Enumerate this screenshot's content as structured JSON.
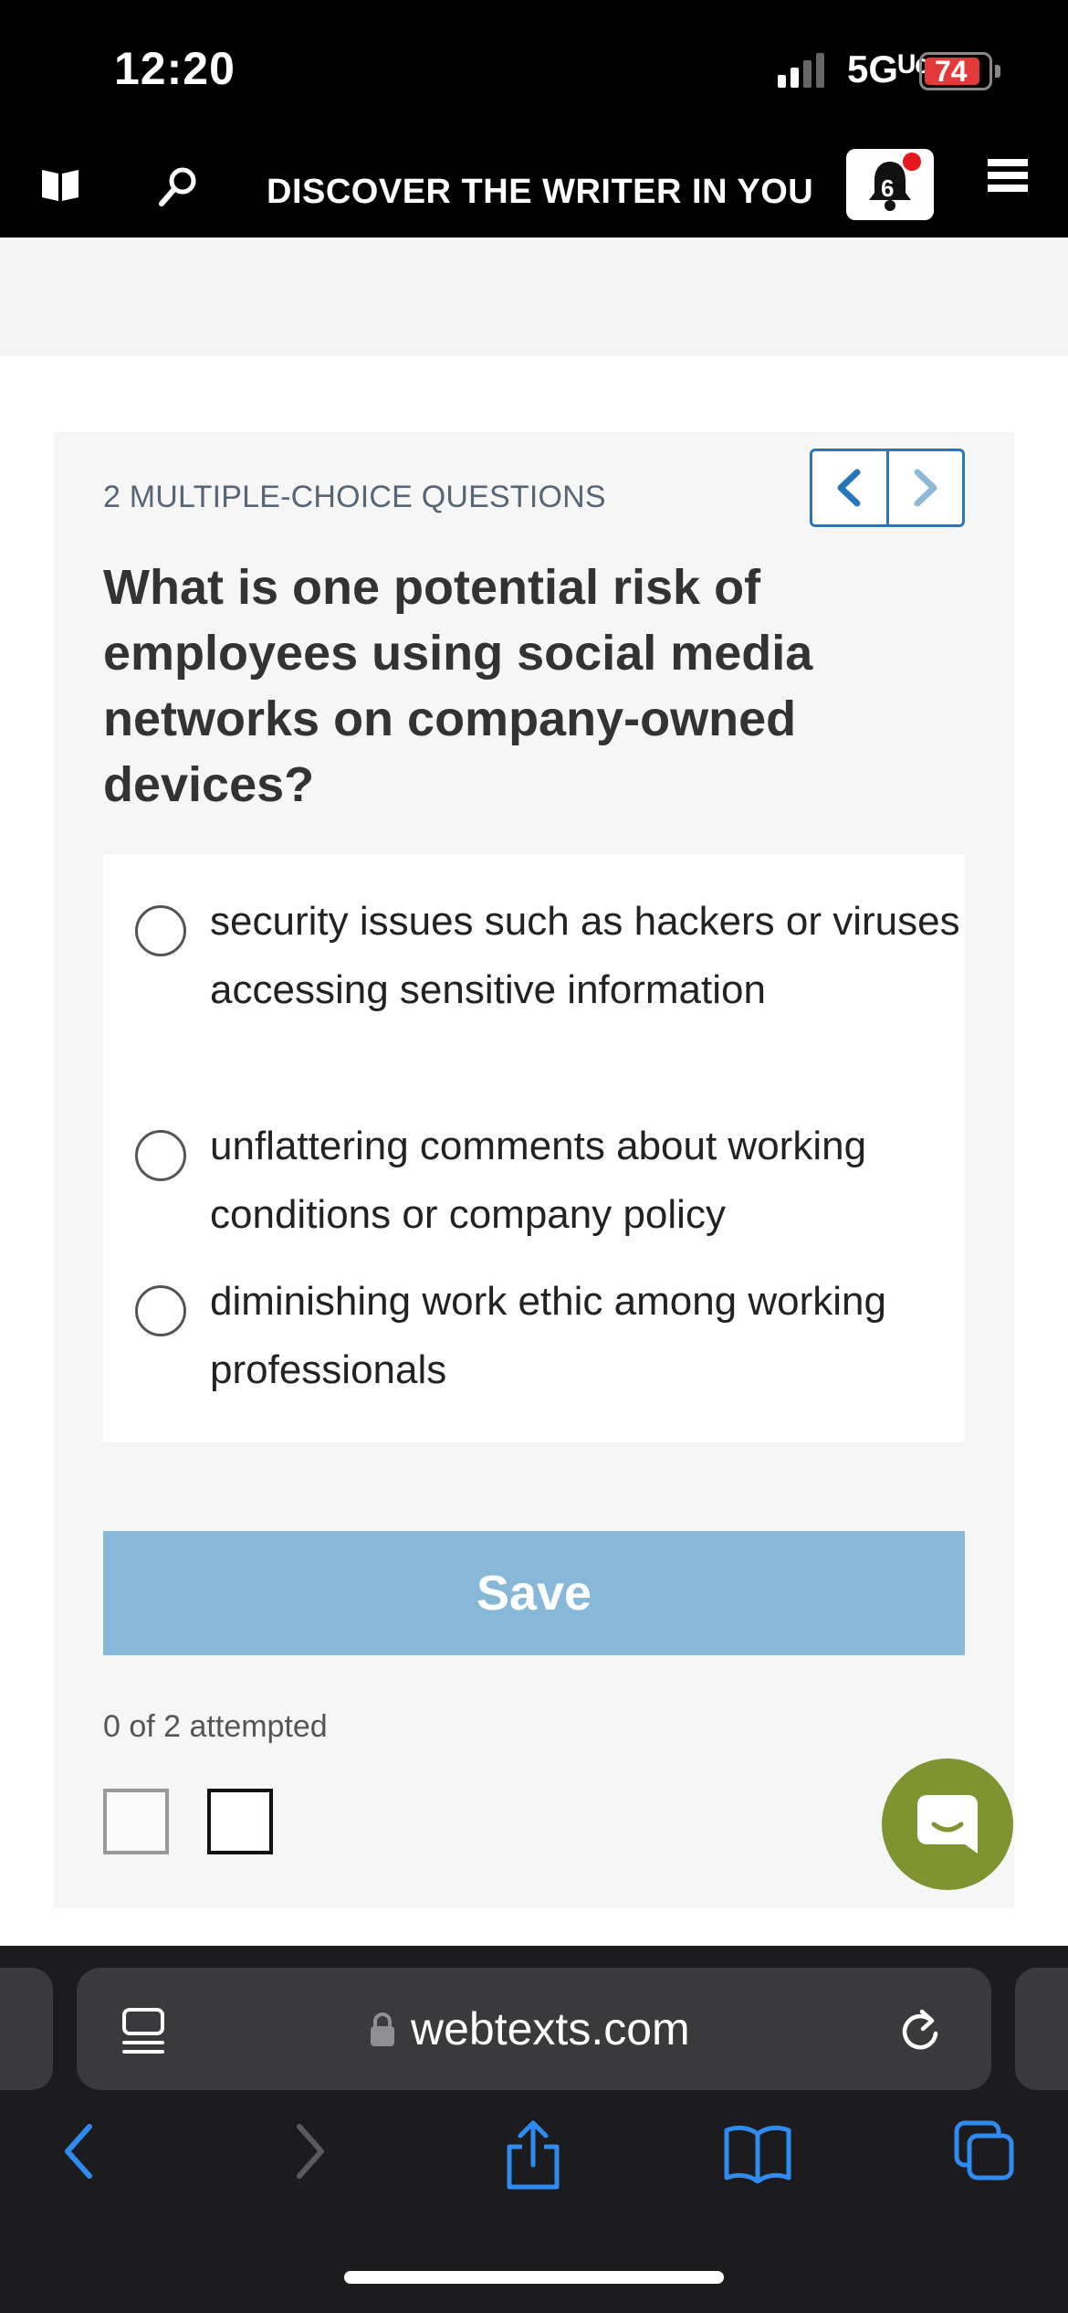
{
  "status_bar": {
    "time": "12:20",
    "network": "5Gᵁᶜ",
    "battery": "74"
  },
  "top_nav": {
    "title": "DISCOVER THE WRITER IN YOU",
    "notification_count": "6"
  },
  "quiz": {
    "heading": "2 MULTIPLE-CHOICE QUESTIONS",
    "question": "What is one potential risk of employees using social media networks on company-owned devices?",
    "options": [
      {
        "label": "security issues such as hackers or viruses accessing sensitive information"
      },
      {
        "label": "unflattering comments about working conditions or company policy"
      },
      {
        "label": "diminishing work ethic among working professionals"
      }
    ],
    "save_label": "Save",
    "attempted": "0 of 2 attempted"
  },
  "browser": {
    "url": "webtexts.com"
  },
  "colors": {
    "accent": "#2776b9",
    "save_button": "#88b8d7",
    "chat_fab": "#7f9431",
    "notification_dot": "#e8171c"
  }
}
